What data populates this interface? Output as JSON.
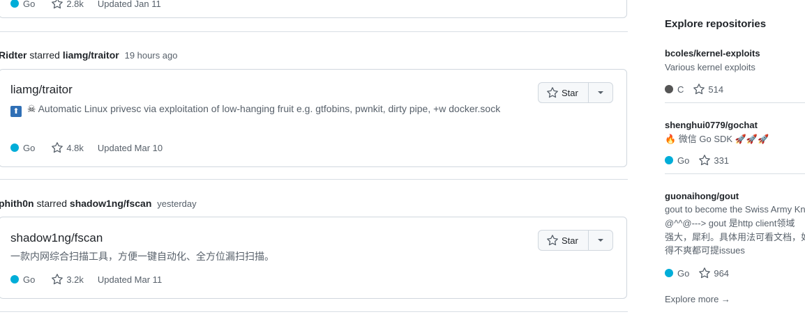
{
  "feed": {
    "top_card": {
      "language": "Go",
      "lang_color": "#00ADD8",
      "stars": "2.8k",
      "updated": "Updated Jan 11"
    },
    "events": [
      {
        "actor": "Ridter",
        "action": "starred",
        "repo": "liamg/traitor",
        "time": "19 hours ago",
        "title": "liamg/traitor",
        "desc_emoji": "⬆",
        "desc_icon": "☠",
        "desc": "Automatic Linux privesc via exploitation of low-hanging fruit e.g. gtfobins, pwnkit, dirty pipe, +w docker.sock",
        "language": "Go",
        "lang_color": "#00ADD8",
        "stars": "4.8k",
        "updated": "Updated Mar 10",
        "star_label": "Star"
      },
      {
        "actor": "phith0n",
        "action": "starred",
        "repo": "shadow1ng/fscan",
        "time": "yesterday",
        "title": "shadow1ng/fscan",
        "desc": "一款内网综合扫描工具，方便一键自动化、全方位漏扫扫描。",
        "language": "Go",
        "lang_color": "#00ADD8",
        "stars": "3.2k",
        "updated": "Updated Mar 11",
        "star_label": "Star"
      }
    ]
  },
  "sidebar": {
    "title": "Explore repositories",
    "repos": [
      {
        "name": "bcoles/kernel-exploits",
        "desc": "Various kernel exploits",
        "language": "C",
        "lang_color": "#555555",
        "stars": "514"
      },
      {
        "name": "shenghui0779/gochat",
        "desc": "🔥 微信 Go SDK 🚀🚀🚀",
        "language": "Go",
        "lang_color": "#00ADD8",
        "stars": "331"
      },
      {
        "name": "guonaihong/gout",
        "desc_lines": [
          "gout to become the Swiss Army Kn",
          "@^^@---> gout 是http client领域",
          "强大，犀利。具体用法可看文档，如",
          "得不爽都可提issues"
        ],
        "language": "Go",
        "lang_color": "#00ADD8",
        "stars": "964"
      }
    ],
    "explore_more": "Explore more →"
  }
}
